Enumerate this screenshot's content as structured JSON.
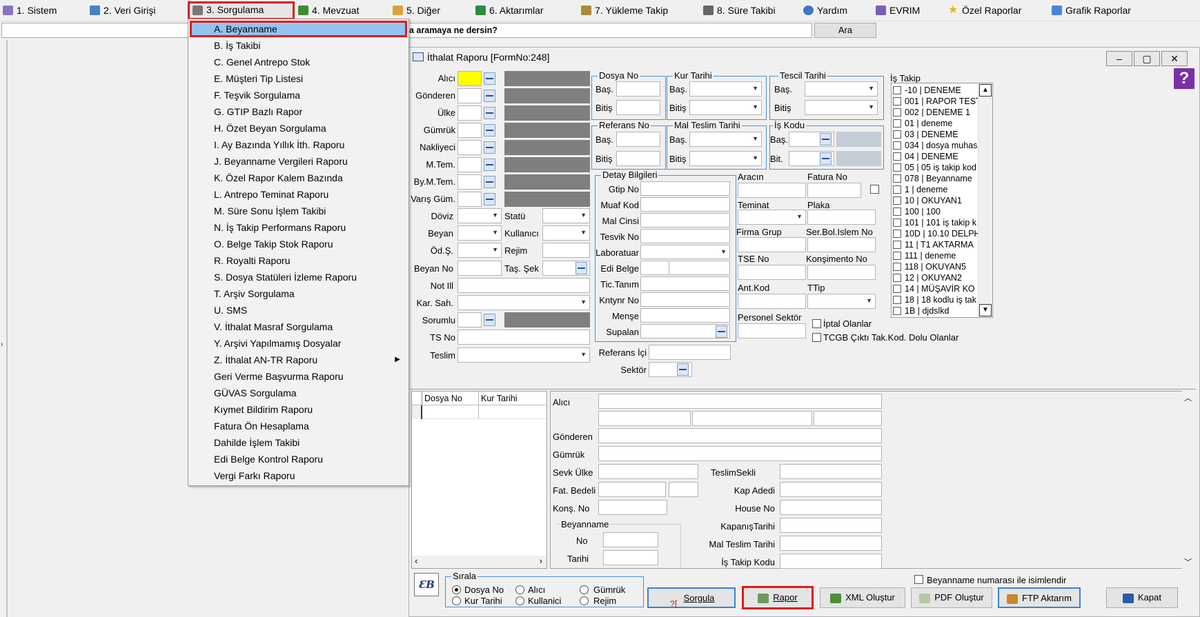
{
  "menubar": {
    "items": [
      {
        "label": "1.   Sistem",
        "icon": "system-icon",
        "color": "#6b4fa8"
      },
      {
        "label": "2.   Veri Girişi",
        "icon": "data-entry-icon",
        "color": "#2a6bbf"
      },
      {
        "label": "3.   Sorgulama",
        "icon": "query-icon",
        "color": "#444"
      },
      {
        "label": "4.   Mevzuat",
        "icon": "legislation-icon",
        "color": "#3c8d2f"
      },
      {
        "label": "5.   Diğer",
        "icon": "other-icon",
        "color": "#c9882a"
      },
      {
        "label": "6.   Aktarımlar",
        "icon": "transfer-icon",
        "color": "#2b8c3f"
      },
      {
        "label": "7.   Yükleme Takip",
        "icon": "loading-track-icon",
        "color": "#8a6d2a"
      },
      {
        "label": "8. Süre Takibi",
        "icon": "timer-icon",
        "color": "#555"
      },
      {
        "label": "Yardım",
        "icon": "help-icon",
        "color": "#2a6bbf"
      },
      {
        "label": "EVRIM",
        "icon": "evrim-icon",
        "color": "#6b4fa8"
      },
      {
        "label": "Özel Raporlar",
        "icon": "star-icon",
        "color": "#e6b800"
      },
      {
        "label": "Grafik Raporlar",
        "icon": "chart-icon",
        "color": "#3a7bd5"
      }
    ]
  },
  "search": {
    "prompt": "a aramaya ne dersin?",
    "button": "Ara"
  },
  "dropdown": {
    "items": [
      "A.  Beyanname",
      "B.  İş Takibi",
      "C.  Genel Antrepo Stok",
      "E.  Müşteri Tip Listesi",
      "F.  Teşvik Sorgulama",
      "G.  GTIP Bazlı Rapor",
      "H.  Özet Beyan Sorgulama",
      "I.   Ay Bazında Yıllık İth. Raporu",
      "J.   Beyanname Vergileri Raporu",
      "K. Özel Rapor Kalem Bazında",
      "L.  Antrepo Teminat Raporu",
      "M.  Süre Sonu İşlem Takibi",
      "N.  İş Takip Performans Raporu",
      "O.  Belge Takip Stok Raporu",
      "R.  Royalti Raporu",
      "S.   Dosya Statüleri İzleme Raporu",
      "T.   Arşiv Sorgulama",
      "U.  SMS",
      "V.  İthalat Masraf Sorgulama",
      "Y.  Arşivi Yapılmamış Dosyalar",
      "Z.  İthalat AN-TR Raporu",
      "Geri Verme Başvurma Raporu",
      "GÜVAS Sorgulama",
      "Kıymet Bildirim Raporu",
      "Fatura Ön Hesaplama",
      "Dahilde İşlem Takibi",
      "Edi Belge Kontrol Raporu",
      "Vergi Farkı Raporu"
    ]
  },
  "window": {
    "title": "İthalat Raporu [FormNo:248]"
  },
  "form": {
    "left_labels": [
      "Alıcı",
      "Gönderen",
      "Ülke",
      "Gümrük",
      "Nakliyeci",
      "M.Tem.",
      "By.M.Tem.",
      "Varış Güm."
    ],
    "doviz": "Döviz",
    "statu": "Statü",
    "beyan": "Beyan",
    "kullanici": "Kullanıcı",
    "ods": "Öd.Ş.",
    "rejim": "Rejim",
    "beyan_no": "Beyan No",
    "tas_sek": "Taş. Şek",
    "not_ill": "Not Ill",
    "kar_sah": "Kar. Sah.",
    "sorumlu": "Sorumlu",
    "ts_no": "TS No",
    "teslim": "Teslim",
    "dosya_no": "Dosya No",
    "kur_tarihi": "Kur Tarihi",
    "tescil_tarihi": "Tescil Tarihi",
    "referans_no": "Referans No",
    "mal_teslim_tarihi": "Mal Teslim Tarihi",
    "is_kodu": "İş Kodu",
    "bas": "Baş.",
    "bitis": "Bitiş",
    "bit": "Bit.",
    "detay": "Detay Bilgileri",
    "detay_labels": [
      "Gtip No",
      "Muaf Kod",
      "Mal Cinsi",
      "Tesvik No",
      "Laboratuar",
      "Edi Belge",
      "Tic.Tanım",
      "Kntynr No",
      "Menşe",
      "Supalan"
    ],
    "aracin": "Aracın",
    "fatura_no": "Fatura No",
    "teminat": "Teminat",
    "plaka": "Plaka",
    "firma_grup": "Firma Grup",
    "ser_bol": "Ser.Bol.Islem No",
    "tse_no": "TSE No",
    "konsimento": "Konşimento No",
    "ant_kod": "Ant.Kod",
    "ttip": "TTip",
    "personel_sektor": "Personel Sektör",
    "iptal": "İptal Olanlar",
    "tcgb": "TCGB Çıktı Tak.Kod. Dolu Olanlar",
    "referans_ici": "Referans İçi",
    "sektor": "Sektör",
    "is_takip": "İş Takip"
  },
  "istakip_items": [
    "-10 | DENEME",
    "001 | RAPOR TEST",
    "002 | DENEME 1",
    "01 | deneme",
    "03 | DENEME",
    "034 | dosya muhas",
    "04 | DENEME",
    "05 | 05 iş takip kod",
    "078 | Beyanname",
    "1 | deneme",
    "10 | OKUYAN1",
    "100 | 100",
    "101 | 101 iş takip k",
    "10D | 10.10 DELPH",
    "11 | T1 AKTARMA",
    "111 | deneme",
    "118 | OKUYAN5",
    "12 | OKUYAN2",
    "14 | MÜŞAVİR KO",
    "18 | 18 kodlu iş tak",
    "1B | djdslkd"
  ],
  "grid": {
    "col1": "Dosya No",
    "col2": "Kur Tarihi"
  },
  "detail": {
    "alici": "Alıcı",
    "gonderen": "Gönderen",
    "gumruk": "Gümrük",
    "sevk_ulke": "Sevk Ülke",
    "fat_bedeli": "Fat. Bedeli",
    "kons_no": "Konş. No",
    "beyanname": "Beyanname",
    "no": "No",
    "tarihi": "Tarihi",
    "teslim_sekli": "TeslimSekli",
    "kap_adedi": "Kap Adedi",
    "house_no": "House No",
    "kapanis_tarihi": "KapanışTarihi",
    "mal_teslim_tarihi": "Mal Teslim Tarihi",
    "is_takip_kodu": "İş Takip Kodu"
  },
  "bottom": {
    "sirala": "Sırala",
    "dosya_no": "Dosya No",
    "alici": "Alıcı",
    "gumruk": "Gümrük",
    "kur_tarihi": "Kur Tarihi",
    "kullanici": "Kullanici",
    "rejim": "Rejim",
    "beyanname_isim": "Beyanname numarası ile isimlendir",
    "sorgula": "Sorgula",
    "rapor": "Rapor",
    "xml": "XML Oluştur",
    "pdf": "PDF Oluştur",
    "ftp": "FTP Aktarım",
    "kapat": "Kapat"
  }
}
